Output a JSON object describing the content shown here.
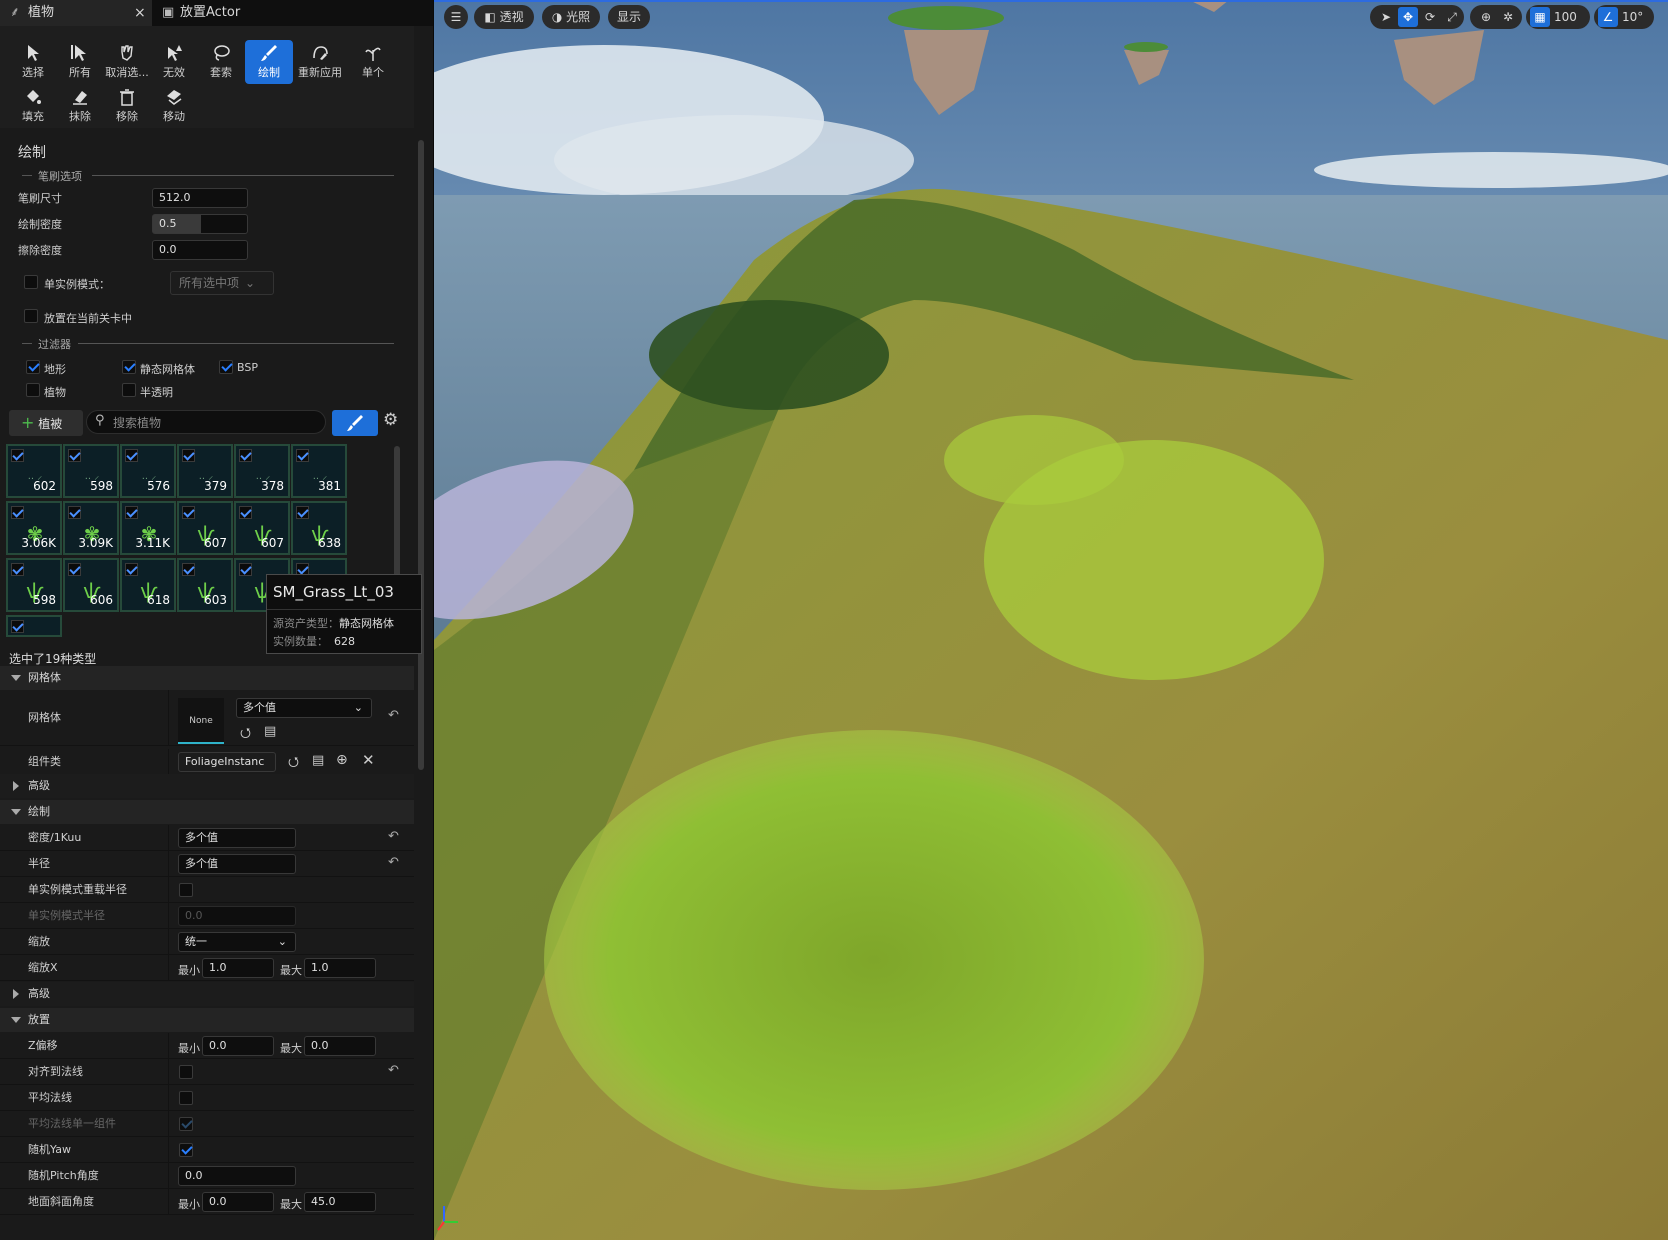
{
  "tabs": {
    "foliage": "植物",
    "close": "×",
    "place_actor": "放置Actor"
  },
  "tools": [
    "选择",
    "所有",
    "取消选...",
    "无效",
    "套索",
    "绘制",
    "重新应用",
    "单个",
    "填充",
    "抹除",
    "移除",
    "移动"
  ],
  "paint": {
    "title": "绘制",
    "brush_options": "笔刷选项",
    "brush_size_label": "笔刷尺寸",
    "brush_size": "512.0",
    "paint_density_label": "绘制密度",
    "paint_density": "0.5",
    "erase_density_label": "擦除密度",
    "erase_density": "0.0",
    "single_instance_label": "单实例模式：",
    "single_instance_option": "所有选中项",
    "place_in_level_label": "放置在当前关卡中",
    "filters": "过滤器",
    "filter_landscape": "地形",
    "filter_static_mesh": "静态网格体",
    "filter_bsp": "BSP",
    "filter_foliage": "植物",
    "filter_translucent": "半透明"
  },
  "foliage_bar": {
    "add_label": "植被",
    "search_placeholder": "搜索植物"
  },
  "palette": [
    "602",
    "598",
    "576",
    "379",
    "378",
    "381",
    "3.06K",
    "3.09K",
    "3.11K",
    "607",
    "607",
    "638",
    "598",
    "606",
    "618",
    "603",
    "",
    ""
  ],
  "tooltip": {
    "name": "SM_Grass_Lt_03",
    "asset_type_label": "源资产类型：",
    "asset_type": "静态网格体",
    "instances_label": "实例数量：",
    "instances": "628"
  },
  "details": {
    "selected_count": "选中了19种类型",
    "cat_mesh": "网格体",
    "mesh_label": "网格体",
    "mesh_thumb": "None",
    "mesh_value": "多个值",
    "component_label": "组件类",
    "component_value": "FoliageInstanc",
    "advanced": "高级",
    "cat_paint": "绘制",
    "density_label": "密度/1Kuu",
    "density_value": "多个值",
    "radius_label": "半径",
    "radius_value": "多个值",
    "single_radius_override_label": "单实例模式重载半径",
    "single_radius_label": "单实例模式半径",
    "single_radius_value": "0.0",
    "scaling_label": "缩放",
    "scaling_value": "统一",
    "scale_x_label": "缩放X",
    "min": "最小",
    "max": "最大",
    "scale_min": "1.0",
    "scale_max": "1.0",
    "advanced2": "高级",
    "cat_place": "放置",
    "z_offset_label": "Z偏移",
    "z_min": "0.0",
    "z_max": "0.0",
    "align_normal_label": "对齐到法线",
    "average_normal_label": "平均法线",
    "avg_single_label": "平均法线单一组件",
    "random_yaw_label": "随机Yaw",
    "random_pitch_label": "随机Pitch角度",
    "random_pitch_value": "0.0",
    "ground_slope_label": "地面斜面角度",
    "slope_min": "0.0",
    "slope_max": "45.0"
  },
  "viewport": {
    "perspective": "透视",
    "lit": "光照",
    "show": "显示",
    "grid_value": "100",
    "angle_value": "10°"
  }
}
